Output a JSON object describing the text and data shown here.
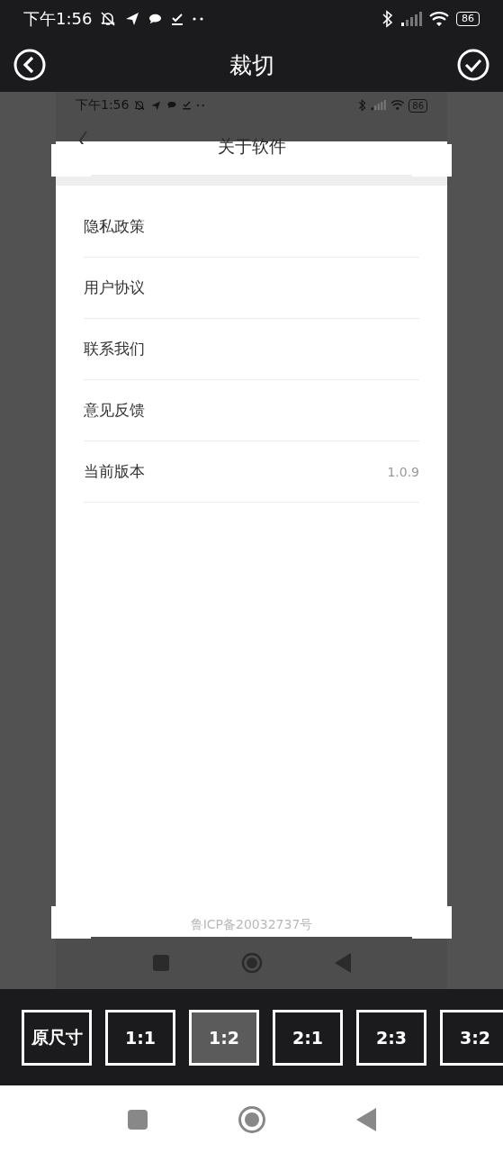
{
  "status_bar": {
    "time": "下午1:56",
    "battery": "86"
  },
  "header": {
    "title": "裁切"
  },
  "preview": {
    "status_bar": {
      "time": "下午1:56",
      "battery": "86"
    },
    "title": "关于软件",
    "items": [
      {
        "label": "隐私政策"
      },
      {
        "label": "用户协议"
      },
      {
        "label": "联系我们"
      },
      {
        "label": "意见反馈"
      },
      {
        "label": "当前版本",
        "value": "1.0.9"
      }
    ],
    "footer": "鲁ICP备20032737号"
  },
  "ratios": [
    {
      "label": "原尺寸",
      "selected": false
    },
    {
      "label": "1:1",
      "selected": false
    },
    {
      "label": "1:2",
      "selected": true
    },
    {
      "label": "2:1",
      "selected": false
    },
    {
      "label": "2:3",
      "selected": false
    },
    {
      "label": "3:2",
      "selected": false
    }
  ]
}
